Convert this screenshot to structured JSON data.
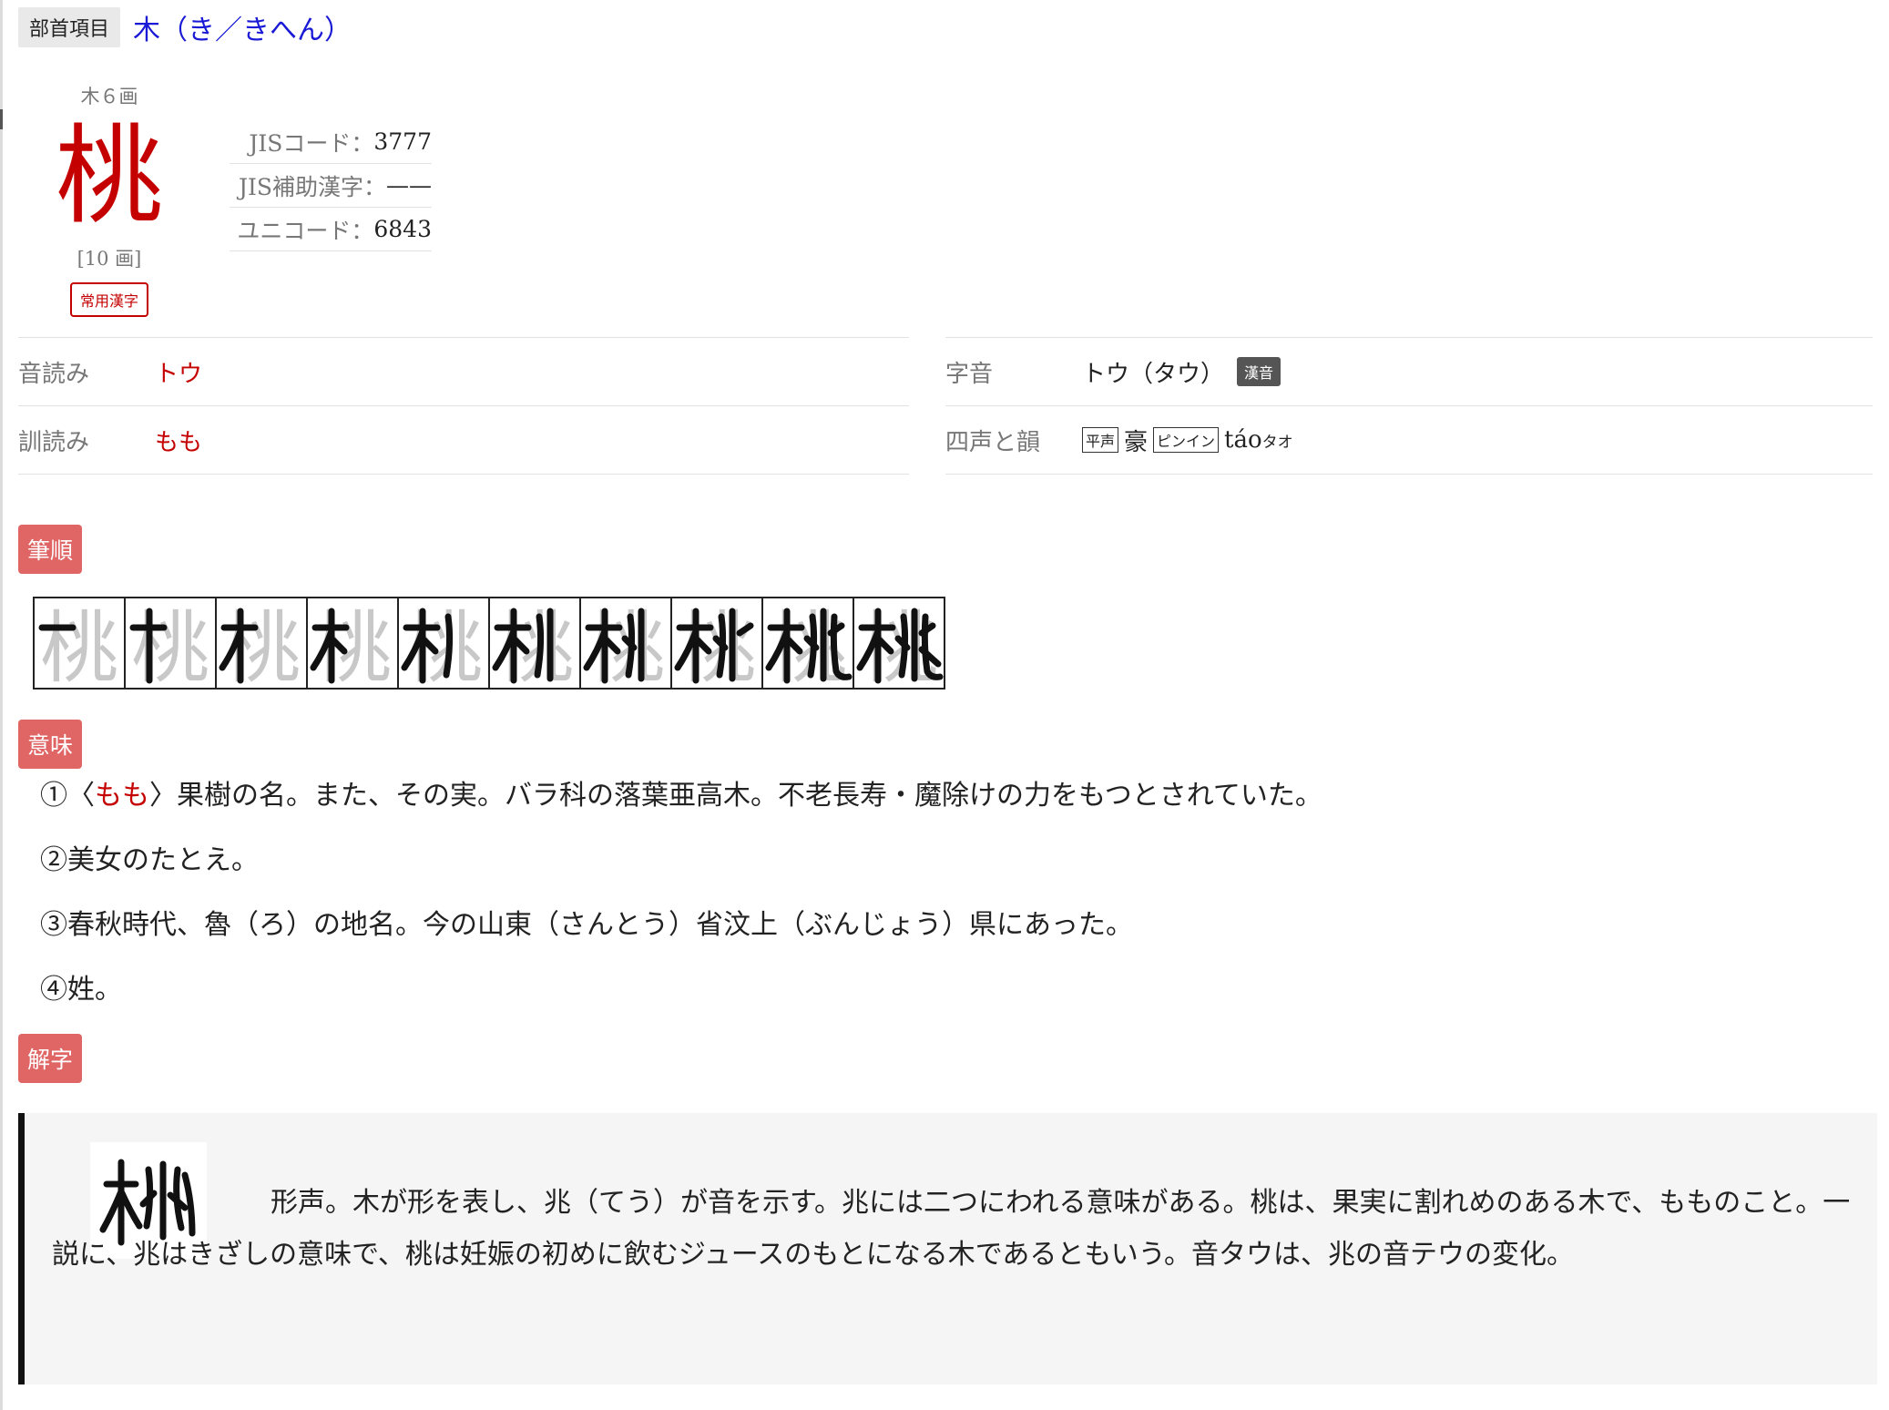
{
  "breadcrumb": {
    "label": "部首項目",
    "link": "木（き／きへん）"
  },
  "kanji": {
    "radical_line": "木６画",
    "character": "桃",
    "stroke_count": "[10 画]",
    "badge": "常用漢字"
  },
  "codes": [
    {
      "label": "JISコード：",
      "value": "3777"
    },
    {
      "label": "JIS補助漢字：",
      "value": "——"
    },
    {
      "label": "ユニコード：",
      "value": "6843"
    }
  ],
  "readings_left": {
    "on_label": "音読み",
    "on_value": "トウ",
    "kun_label": "訓読み",
    "kun_value": "もも"
  },
  "readings_right": {
    "jion_label": "字音",
    "jion_value": "トウ（タウ）",
    "jion_tag": "漢音",
    "shisei_label": "四声と韻",
    "tone_tag": "平声",
    "rhyme": "豪",
    "pinyin_tag": "ピンイン",
    "pinyin": "táo",
    "pinyin_kana": "タオ"
  },
  "sections": {
    "stroke_order": "筆順",
    "meaning": "意味",
    "kaiji": "解字"
  },
  "stroke_order": {
    "character": "桃",
    "steps": 10
  },
  "meanings": {
    "m1_num": "①〈",
    "m1_kun": "もも",
    "m1_rest": "〉果樹の名。また、その実。バラ科の落葉亜高木。不老長寿・魔除けの力をもつとされていた。",
    "m2": "②美女のたとえ。",
    "m3": "③春秋時代、魯（ろ）の地名。今の山東（さんとう）省汶上（ぶんじょう）県にあった。",
    "m4": "④姓。"
  },
  "kaiji": {
    "text": "形声。木が形を表し、兆（てう）が音を示す。兆には二つにわれる意味がある。桃は、果実に割れめのある木で、もものこと。一説に、兆はきざしの意味で、桃は妊娠の初めに飲むジュースのもとになる木であるともいう。音タウは、兆の音テウの変化。"
  },
  "colors": {
    "accent_red": "#c50000",
    "badge_red": "#e06666",
    "link_blue": "#1a1ad6"
  }
}
